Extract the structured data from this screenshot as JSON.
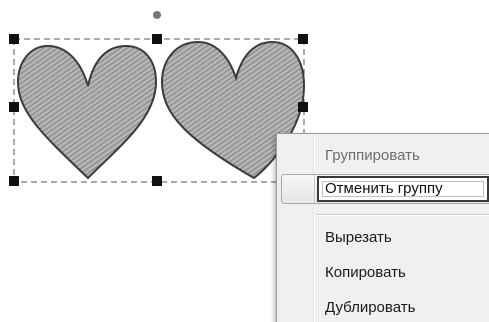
{
  "canvas": {
    "objects": [
      {
        "shape": "heart",
        "fill": "hatched-gray"
      },
      {
        "shape": "heart",
        "fill": "hatched-gray"
      }
    ],
    "selection": {
      "handles": [
        "top-left",
        "top-center",
        "top-right",
        "middle-left",
        "middle-right",
        "bottom-left",
        "bottom-center"
      ],
      "rotate_handle": "rotate-handle-icon"
    }
  },
  "context_menu": {
    "items": [
      {
        "label": "Группировать",
        "enabled": false
      },
      {
        "label": "Отменить группу",
        "enabled": true,
        "highlighted": true
      },
      {
        "label": "Вырезать",
        "enabled": true
      },
      {
        "label": "Копировать",
        "enabled": true
      },
      {
        "label": "Дублировать",
        "enabled": true
      }
    ]
  },
  "colors": {
    "heart_fill": "#9a9a9a",
    "heart_outline": "#3c3c3c",
    "menu_background": "#f0f0f0",
    "handle": "#111111",
    "selection_dash": "#555555"
  }
}
